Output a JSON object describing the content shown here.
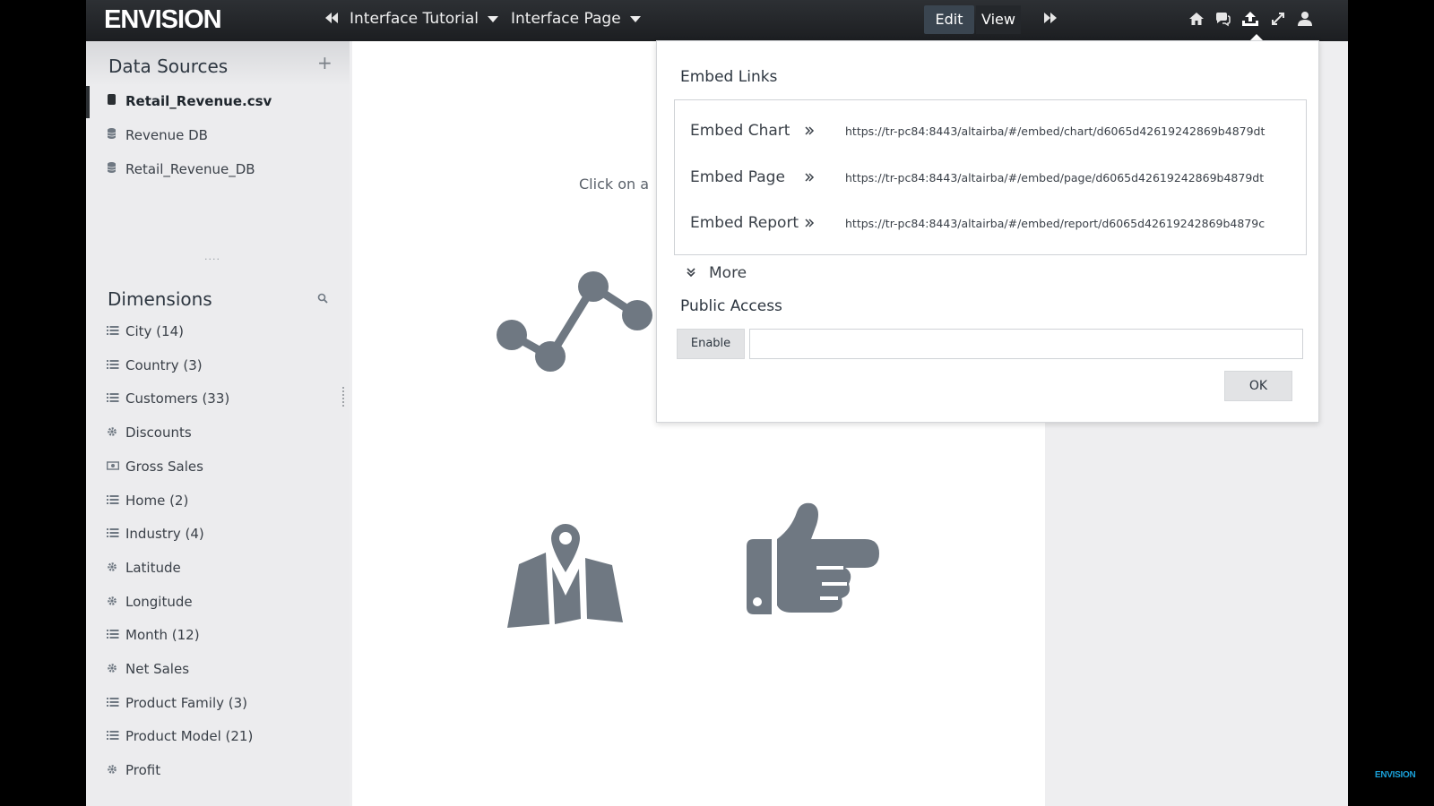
{
  "app": {
    "logo": "ENVISION",
    "tutorial_name": "Interface Tutorial",
    "page_name": "Interface Page",
    "mode_edit": "Edit",
    "mode_view": "View"
  },
  "toolbar_icons": [
    "rewind-icon",
    "fast-forward-icon",
    "home-icon",
    "chat-icon",
    "upload-icon",
    "expand-icon",
    "user-icon"
  ],
  "data_sources": {
    "title": "Data Sources",
    "items": [
      {
        "label": "Retail_Revenue.csv",
        "active": true
      },
      {
        "label": "Revenue DB",
        "active": false
      },
      {
        "label": "Retail_Revenue_DB",
        "active": false
      }
    ]
  },
  "dimensions": {
    "title": "Dimensions",
    "items": [
      {
        "label": "City  (14)",
        "icon": "list-icon"
      },
      {
        "label": "Country  (3)",
        "icon": "list-icon"
      },
      {
        "label": "Customers  (33)",
        "icon": "list-icon"
      },
      {
        "label": "Discounts",
        "icon": "gear-icon"
      },
      {
        "label": "Gross Sales",
        "icon": "money-icon"
      },
      {
        "label": "Home  (2)",
        "icon": "list-icon"
      },
      {
        "label": "Industry  (4)",
        "icon": "list-icon"
      },
      {
        "label": "Latitude",
        "icon": "gear-icon"
      },
      {
        "label": "Longitude",
        "icon": "gear-icon"
      },
      {
        "label": "Month  (12)",
        "icon": "list-icon"
      },
      {
        "label": "Net Sales",
        "icon": "gear-icon"
      },
      {
        "label": "Product Family  (3)",
        "icon": "list-icon"
      },
      {
        "label": "Product Model  (21)",
        "icon": "list-icon"
      },
      {
        "label": "Profit",
        "icon": "gear-icon"
      }
    ]
  },
  "canvas": {
    "hint": "Click on a"
  },
  "embed": {
    "title": "Embed Links",
    "links": [
      {
        "name": "Embed Chart",
        "url": "https://tr-pc84:8443/altairba/#/embed/chart/d6065d42619242869b4879dt"
      },
      {
        "name": "Embed Page",
        "url": "https://tr-pc84:8443/altairba/#/embed/page/d6065d42619242869b4879dt"
      },
      {
        "name": "Embed Report",
        "url": "https://tr-pc84:8443/altairba/#/embed/report/d6065d42619242869b4879c"
      }
    ],
    "more_label": "More",
    "public_access_title": "Public Access",
    "enable_label": "Enable",
    "public_url_value": "",
    "ok_label": "OK"
  },
  "watermark": "ENVISION",
  "colors": {
    "topbar": "#1c1e21",
    "panel": "#ececee",
    "icon_gray": "#6f7882",
    "watermark": "#1aa0d8"
  }
}
